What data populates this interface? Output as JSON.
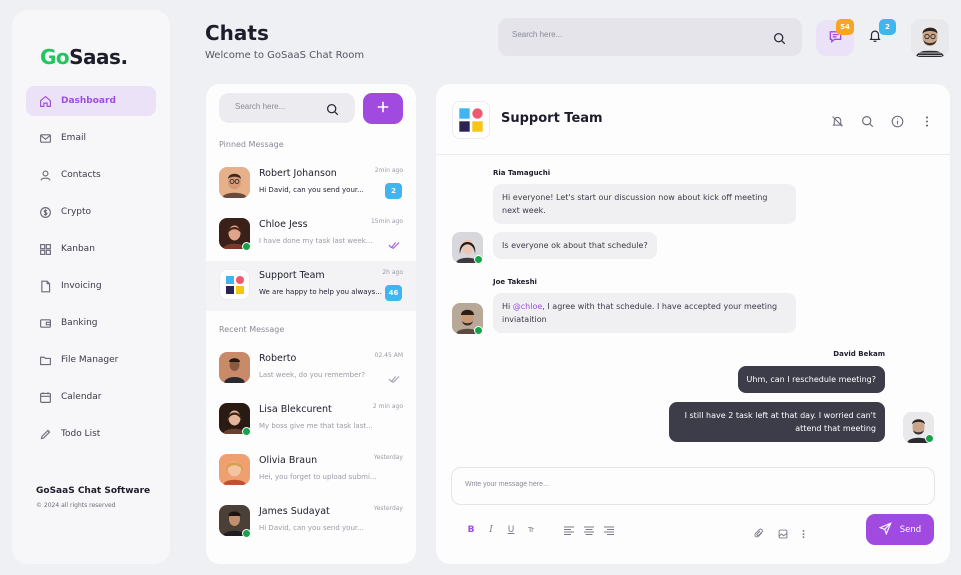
{
  "brand": {
    "logo_go": "Go",
    "logo_rest": "Saas.",
    "accent": "#a04ae0",
    "logo_green": "#22c55e"
  },
  "sidebar": {
    "items": [
      {
        "label": "Dashboard",
        "icon": "home-icon",
        "active": true
      },
      {
        "label": "Email",
        "icon": "mail-icon"
      },
      {
        "label": "Contacts",
        "icon": "user-icon"
      },
      {
        "label": "Crypto",
        "icon": "coin-icon"
      },
      {
        "label": "Kanban",
        "icon": "grid-icon"
      },
      {
        "label": "Invoicing",
        "icon": "document-icon"
      },
      {
        "label": "Banking",
        "icon": "wallet-icon"
      },
      {
        "label": "File Manager",
        "icon": "folder-icon"
      },
      {
        "label": "Calendar",
        "icon": "calendar-icon"
      },
      {
        "label": "Todo List",
        "icon": "pencil-icon"
      }
    ],
    "footer_title": "GoSaaS Chat Software",
    "footer_copy": "© 2024 all rights reserved"
  },
  "header": {
    "title": "Chats",
    "subtitle": "Welcome to GoSaaS Chat Room",
    "search_placeholder": "Search here...",
    "messages_badge": "54",
    "notifications_badge": "2"
  },
  "chat_list": {
    "search_placeholder": "Search here...",
    "add_label": "+",
    "pinned_label": "Pinned Message",
    "recent_label": "Recent Message",
    "pinned": [
      {
        "name": "Robert Johanson",
        "preview": "Hi David, can you send your...",
        "time": "2min ago",
        "unread": "2",
        "online": false
      },
      {
        "name": "Chloe Jess",
        "preview": "I have done my task last week...",
        "time": "15min ago",
        "online": true
      },
      {
        "name": "Support Team",
        "preview": "We are happy to help you always...",
        "time": "2h ago",
        "unread": "46",
        "selected": true
      }
    ],
    "recent": [
      {
        "name": "Roberto",
        "preview": "Last week, do you remember?",
        "time": "02.45 AM",
        "online": false
      },
      {
        "name": "Lisa Blekcurent",
        "preview": "My boss give me that task last...",
        "time": "2 min ago",
        "online": true
      },
      {
        "name": "Olivia Braun",
        "preview": "Hei, you forget to upload submi...",
        "time": "Yesterday",
        "online": false
      },
      {
        "name": "James Sudayat",
        "preview": "Hi David, can you send your...",
        "time": "Yesterday",
        "online": true
      }
    ]
  },
  "chat": {
    "title": "Support Team",
    "messages": {
      "ria_name": "Ria Tamaguchi",
      "ria_1": "Hi everyone! Let's start our discussion now about kick off meeting next week.",
      "ria_2": "Is everyone ok about that schedule?",
      "joe_name": "Joe Takeshi",
      "joe_pre": "Hi ",
      "joe_mention": "@chloe",
      "joe_post": ", I agree with that schedule. I have accepted your meeting inviataition",
      "david_name": "David Bekam",
      "david_1": "Uhm, can I reschedule meeting?",
      "david_2": "I still have 2 task left at that day. I worried can't attend that meeting"
    },
    "composer_placeholder": "Write your message here...",
    "send_label": "Send"
  }
}
